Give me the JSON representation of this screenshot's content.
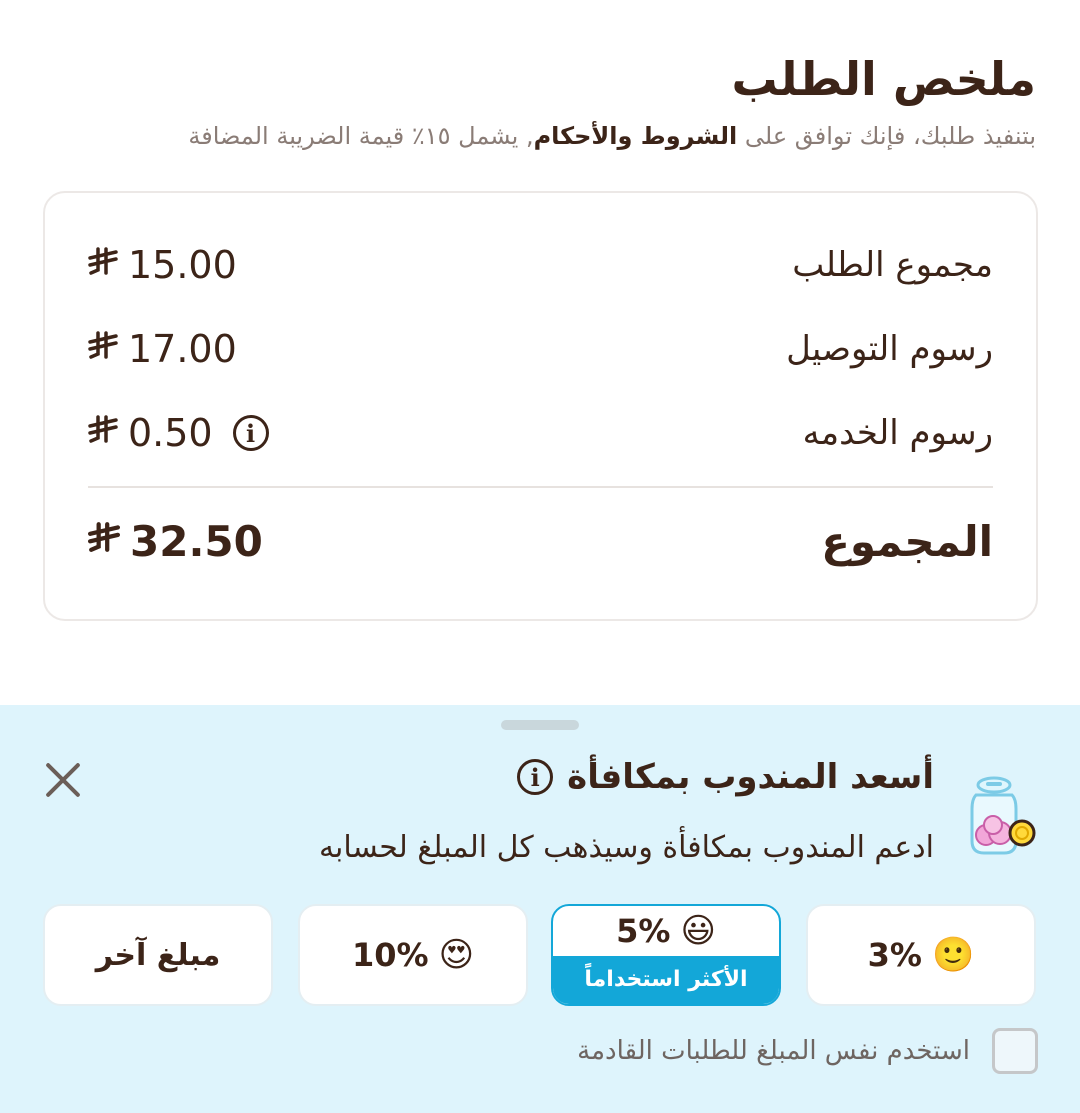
{
  "order_summary": {
    "title": "ملخص الطلب",
    "subtitle_prefix": "بتنفيذ طلبك، فإنك توافق على ",
    "terms_link": "الشروط والأحكام",
    "subtitle_suffix": ", يشمل ١٥٪ قيمة الضريبة المضافة",
    "currency_symbol": "⃁",
    "rows": [
      {
        "label": "مجموع الطلب",
        "amount": "15.00"
      },
      {
        "label": "رسوم التوصيل",
        "amount": "17.00"
      },
      {
        "label": "رسوم الخدمه",
        "amount": "0.50"
      }
    ],
    "total": {
      "label": "المجموع",
      "amount": "32.50"
    }
  },
  "tip": {
    "title": "أسعد المندوب بمكافأة",
    "description": "ادعم المندوب بمكافأة وسيذهب كل المبلغ لحسابه",
    "options": [
      {
        "emoji": "🙂",
        "value": "3%"
      },
      {
        "emoji": "😃",
        "value": "5%",
        "badge": "الأكثر استخداماً"
      },
      {
        "emoji": "😍",
        "value": "10%"
      },
      {
        "label": "مبلغ آخر"
      }
    ],
    "remember_label": "استخدم نفس المبلغ للطلبات القادمة"
  },
  "colors": {
    "text": "#3c2418",
    "sheet_bg": "#def4fc",
    "accent": "#13a7d8"
  }
}
